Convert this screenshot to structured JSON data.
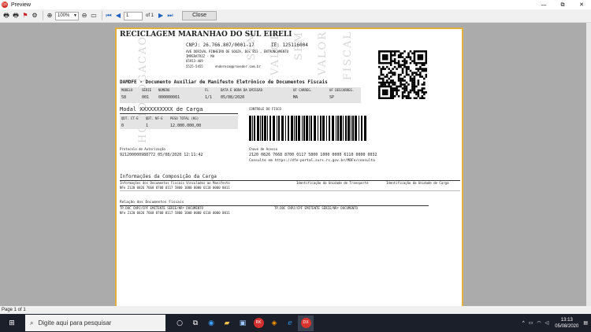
{
  "window": {
    "title": "Preview",
    "minimize": "—",
    "maximize": "⧉",
    "close": "✕"
  },
  "toolbar": {
    "zoom": "100%",
    "page": "1",
    "of_label": "of 1",
    "close_label": "Close"
  },
  "status": {
    "page_info": "Page 1 of 1"
  },
  "doc": {
    "company": "RECICLAGEM MARANHAO DO SUL EIRELI",
    "cnpj": "CNPJ: 26.766.807/0001-17",
    "ie": "IE: 125116004",
    "address1": "AVE DORIVAL PINHEIRO DE SOUZA, Box 853 , ENTRONCAMENTO",
    "address2": "IMPERATRIZ - MA",
    "cep": "65913-469",
    "phone": "5525-5455",
    "email": "endereco@provedor.com.br",
    "watermark": [
      "H",
      "O",
      "M",
      "O",
      "L",
      "O",
      "G",
      "A",
      "C",
      "A",
      "O",
      "S",
      "E",
      "M",
      "V",
      "A",
      "L",
      "O",
      "R",
      "F",
      "I",
      "S",
      "C",
      "A",
      "L"
    ],
    "damdfe_title": "DAMDFE - Documento Auxiliar de Manifesto Eletrônico de Documentos Fiscais",
    "hdr_modelo": "MODELO",
    "hdr_serie": "SÉRIE",
    "hdr_numero": "NÚMERO",
    "hdr_fl": "FL",
    "hdr_data": "DATA E HORA DA EMISSÃO",
    "hdr_ufc": "UF CARREG.",
    "hdr_ufd": "UF DESCARREG.",
    "val_modelo": "58",
    "val_serie": "001",
    "val_numero": "000000061",
    "val_fl": "1/1",
    "val_data": "05/08/2020",
    "val_ufc": "MA",
    "val_ufd": "SP",
    "modal": "Modal XXXXXXXXXX de Carga",
    "controle_fisco": "CONTROLE DO FISCO",
    "hdr_qtd_cte": "QDT. CT-E",
    "hdr_qtd_nfe": "QDT. NF-E",
    "hdr_peso": "PESO TOTAL (KG)",
    "val_qtd_cte": "0",
    "val_qtd_nfe": "1",
    "val_peso": "12.000.000,00",
    "protocolo_lbl": "Protocolo de Autorização",
    "protocolo_val": "921200000988772    05/08/2020 12:11:42",
    "chave_lbl": "Chave de Acesso",
    "chave_val": "2120 0826 7668 8700 0117 5800 1000 0000 6110 0000 0032",
    "consulta": "Consulte em https://dfe-portal.svrs.rs.gov.br/MDFe/consulta",
    "composicao_title": "Informações da Composição da Carga",
    "comp_col1": "Informações dos Documentos Fiscais Vinculados ao Manifesto",
    "comp_col2": "Identificação da Unidade de Transporte",
    "comp_col3": "Identificação da Unidade de Carga",
    "comp_row": "NFe     2120 0826 7668 8700 0117 5800 1000 0000 6110 0000 0011",
    "relacao_title": "Relação dos Documentos Fiscais",
    "rel_col1": "TP.DOC CNPJ/CPF EMITENTE          SÉRIE/NRº DOCUMENTO",
    "rel_col2": "TP.DOC CNPJ/CPF EMITENTE          SÉRIE/NRº DOCUMENTO",
    "rel_row": "NFe     2120 0826 7668 8700 0117 5800 1000 0000 6110 0000 0011"
  },
  "taskbar": {
    "search_placeholder": "Digite aqui para pesquisar",
    "icons": [
      "windows-logo",
      "search",
      "cortana",
      "task-view",
      "edge",
      "file-explorer",
      "store",
      "rk-app",
      "app-orange",
      "ie",
      "dx-app"
    ],
    "time": "13:13",
    "date": "05/08/2020"
  }
}
